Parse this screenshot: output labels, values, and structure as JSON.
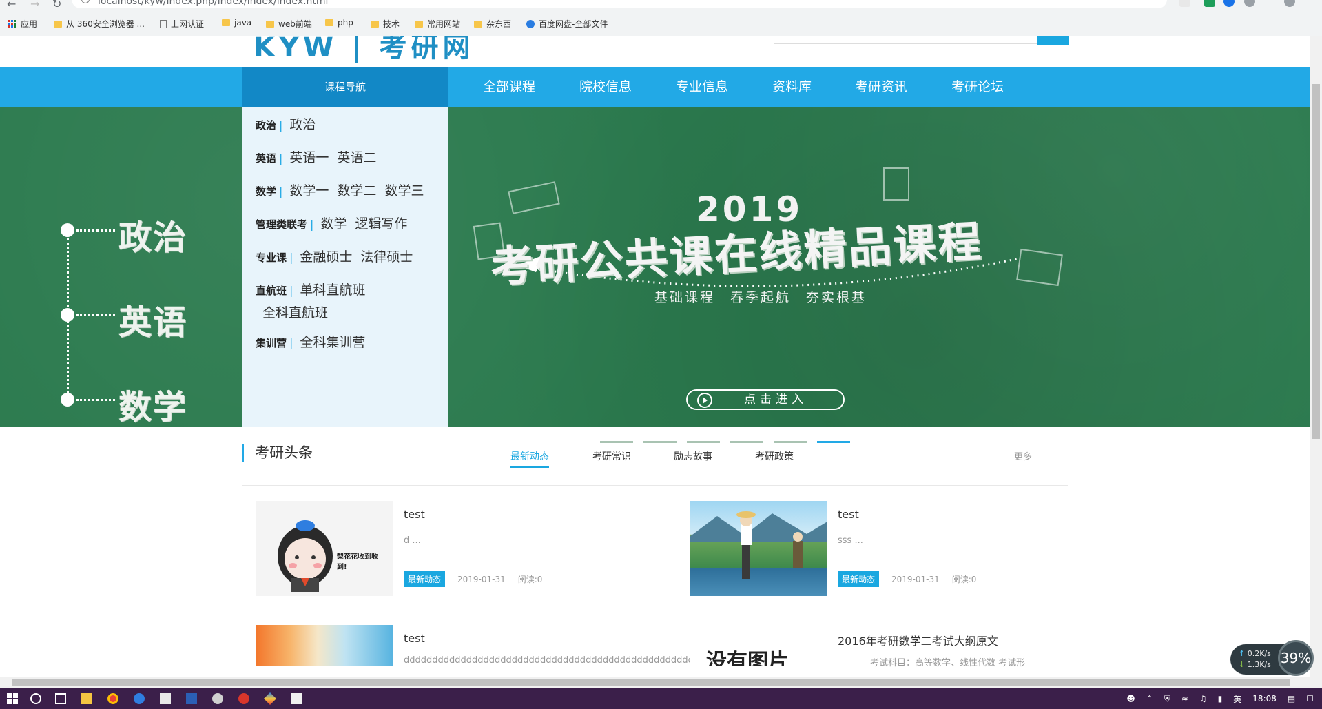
{
  "browser": {
    "url": "localhost/kyw/index.php/index/index/index.html",
    "bookmarks": [
      "应用",
      "从 360安全浏览器 ...",
      "上网认证",
      "java",
      "web前端",
      "php",
      "技术",
      "常用网站",
      "杂东西",
      "百度网盘-全部文件"
    ]
  },
  "nav": {
    "course_nav_label": "课程导航",
    "links": [
      "全部课程",
      "院校信息",
      "专业信息",
      "资料库",
      "考研资讯",
      "考研论坛"
    ]
  },
  "course_nav": [
    {
      "name": "政治",
      "items": [
        "政治"
      ]
    },
    {
      "name": "英语",
      "items": [
        "英语一",
        "英语二"
      ]
    },
    {
      "name": "数学",
      "items": [
        "数学一",
        "数学二",
        "数学三"
      ]
    },
    {
      "name": "管理类联考",
      "items": [
        "数学",
        "逻辑写作"
      ]
    },
    {
      "name": "专业课",
      "items": [
        "金融硕士",
        "法律硕士"
      ]
    },
    {
      "name": "直航班",
      "items": [
        "单科直航班",
        "全科直航班"
      ]
    },
    {
      "name": "集训营",
      "items": [
        "全科集训营"
      ]
    }
  ],
  "banner": {
    "subjects": [
      "政治",
      "英语",
      "数学"
    ],
    "year": "2019",
    "title": "考研公共课在线精品课程",
    "subtitle": [
      "基础课程",
      "春季起航",
      "夯实根基"
    ],
    "button": "点击进入",
    "slide_count": 6,
    "active_slide": 6
  },
  "news": {
    "title": "考研头条",
    "tabs": [
      "最新动态",
      "考研常识",
      "励志故事",
      "考研政策"
    ],
    "active_tab": "最新动态",
    "more": "更多",
    "cards": [
      {
        "title": "test",
        "desc": "d ...",
        "tag": "最新动态",
        "date": "2019-01-31",
        "reads": "阅读:0",
        "thumb_caption": "梨花花收到收到!"
      },
      {
        "title": "test",
        "desc": "sss ...",
        "tag": "最新动态",
        "date": "2019-01-31",
        "reads": "阅读:0"
      },
      {
        "title": "test",
        "desc": "dddddddddddddddddddddddddddddddddddddddddddddddddddddd ...",
        "tag": "",
        "date": "",
        "reads": ""
      },
      {
        "title": "2016年考研数学二考试大纲原文",
        "desc": "考试科目：高等数学、线性代数      考试形",
        "tag": "",
        "date": "",
        "reads": "",
        "thumb_caption": "没有图片"
      }
    ]
  },
  "speed_widget": {
    "up": "0.2K/s",
    "down": "1.3K/s",
    "percent": "39%"
  },
  "taskbar": {
    "ime": "英",
    "time": "18:08"
  },
  "colors": {
    "primary": "#22a9e6",
    "nav_dark": "#1288c6",
    "banner_green": "#2b7a4e",
    "panel_bg": "#e8f4fb",
    "taskbar": "#3b1f4a"
  }
}
